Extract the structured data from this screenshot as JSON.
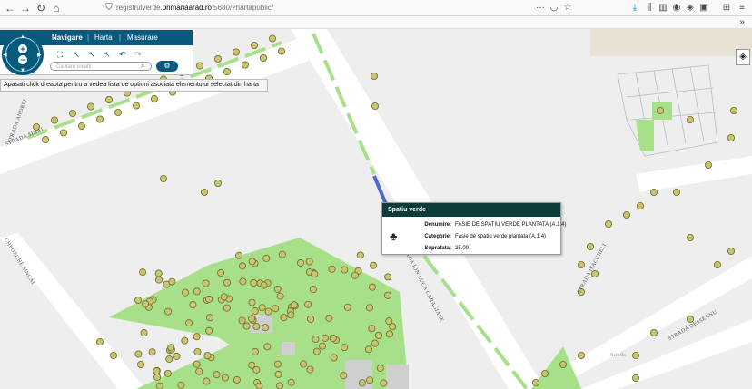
{
  "browser": {
    "url_prefix": "registrulverde.",
    "url_host": "primariaarad.ro",
    "url_rest": ":5680/?hartapublic/",
    "back_icon": "arrow-left-icon",
    "forward_icon": "arrow-right-icon",
    "reload_icon": "reload-icon",
    "home_icon": "home-icon",
    "overflow_label": "»"
  },
  "nav_panel": {
    "tabs": [
      {
        "label": "Navigare"
      },
      {
        "label": "Harta"
      },
      {
        "label": "Masurare"
      }
    ],
    "separator": "|",
    "zoom_in": "+",
    "zoom_out": "−",
    "search_placeholder": "Cautare locatii",
    "go_label": "⚙",
    "tooltip": "Apasati click dreapta pentru a vedea lista de optiuni asociata elementului selectat din harta"
  },
  "popup": {
    "title": "Spatiu verde",
    "rows": [
      {
        "label": "Denumire:",
        "value": "FASIE DE SPATIU VERDE PLANTATA (A.1.4)"
      },
      {
        "label": "Categorie:",
        "value": "Fasie de spatiu verde plantata (A.1.4)"
      },
      {
        "label": "Suprafata:",
        "value": "25.09"
      }
    ]
  },
  "streets": [
    {
      "name": "STRADA ANDREI"
    },
    {
      "name": "STRADA SINAI"
    },
    {
      "name": "CHEORGHE SINCAI"
    },
    {
      "name": "STRADA ION LUCA CARAGIALE"
    },
    {
      "name": "STRADA ISACCHELI"
    },
    {
      "name": "STRADA DESSEANU"
    },
    {
      "name": "Strada"
    }
  ],
  "colors": {
    "panel": "#075a7b",
    "green_area": "#a8e08a",
    "tree": "#c8c870",
    "selected_strip": "#5566cc",
    "road": "#ffffff"
  }
}
